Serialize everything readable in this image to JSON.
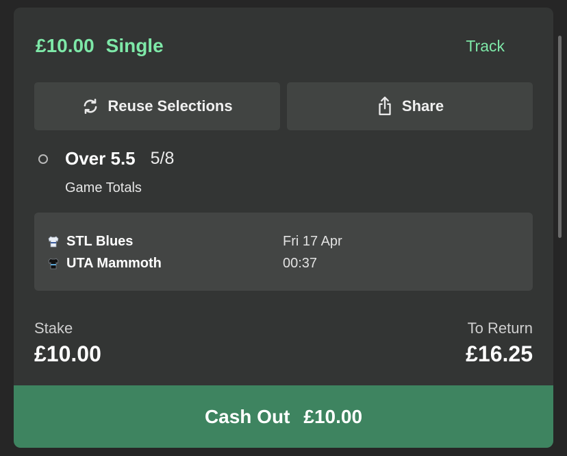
{
  "header": {
    "stake_amount": "£10.00",
    "bet_type": "Single",
    "track_label": "Track"
  },
  "actions": {
    "reuse_label": "Reuse Selections",
    "share_label": "Share"
  },
  "selection": {
    "market_name": "Over 5.5",
    "odds": "5/8",
    "market_type": "Game Totals"
  },
  "event": {
    "home_team": "STL Blues",
    "away_team": "UTA Mammoth",
    "date": "Fri 17 Apr",
    "time": "00:37"
  },
  "totals": {
    "stake_label": "Stake",
    "stake_value": "£10.00",
    "return_label": "To Return",
    "return_value": "£16.25"
  },
  "cashout": {
    "label": "Cash Out",
    "amount": "£10.00"
  },
  "colors": {
    "accent": "#7ee8a8",
    "cashout": "#3e8460",
    "card": "#333534",
    "panel": "#414442"
  }
}
